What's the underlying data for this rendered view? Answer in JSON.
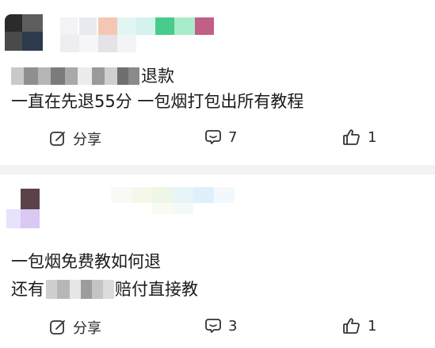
{
  "posts": [
    {
      "title_suffix": "退款",
      "body": "一直在先退55分 一包烟打包出所有教程",
      "actions": {
        "share_label": "分享",
        "comment_count": "7",
        "like_count": "1"
      }
    },
    {
      "title": "一包烟免费教如何退",
      "body_prefix": "还有",
      "body_suffix": "赔付直接教",
      "actions": {
        "share_label": "分享",
        "comment_count": "3",
        "like_count": "1"
      }
    }
  ],
  "colors": {
    "divider": "#f2f2f4",
    "icon": "#333333",
    "text": "#1a1a1a"
  }
}
